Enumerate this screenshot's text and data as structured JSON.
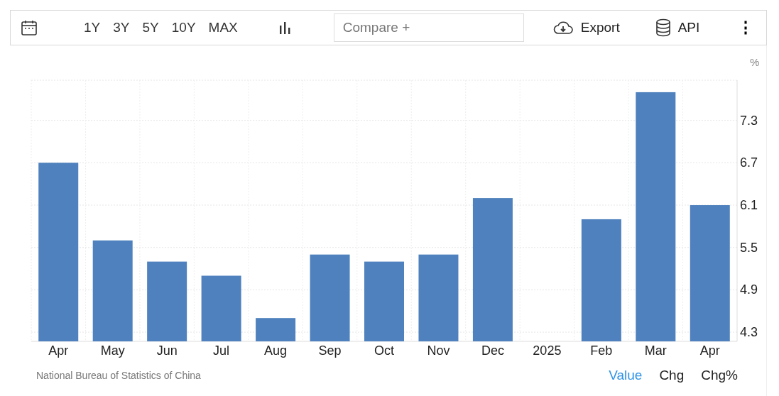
{
  "toolbar": {
    "ranges": [
      "1Y",
      "3Y",
      "5Y",
      "10Y",
      "MAX"
    ],
    "compare": {
      "placeholder": "Compare +"
    },
    "export": "Export",
    "api": "API",
    "more": "⋮"
  },
  "chart": {
    "unit": "%",
    "chart_data": {
      "type": "bar",
      "categories": [
        "Apr",
        "May",
        "Jun",
        "Jul",
        "Aug",
        "Sep",
        "Oct",
        "Nov",
        "Dec",
        "2025",
        "Feb",
        "Mar",
        "Apr"
      ],
      "grid": true,
      "series": [
        {
          "color": "#4e81bd",
          "values": [
            6.7,
            5.6,
            5.3,
            5.1,
            4.5,
            5.4,
            5.3,
            5.4,
            6.2,
            null,
            5.9,
            7.7,
            6.1
          ]
        }
      ],
      "ylim": [
        4.17,
        7.87
      ],
      "yticks": [
        4.3,
        4.9,
        5.5,
        6.1,
        6.7,
        7.3
      ]
    }
  },
  "footer": {
    "source": "National Bureau of Statistics of China",
    "views": [
      {
        "label": "Value",
        "selected": true
      },
      {
        "label": "Chg",
        "selected": false
      },
      {
        "label": "Chg%",
        "selected": false
      }
    ]
  }
}
